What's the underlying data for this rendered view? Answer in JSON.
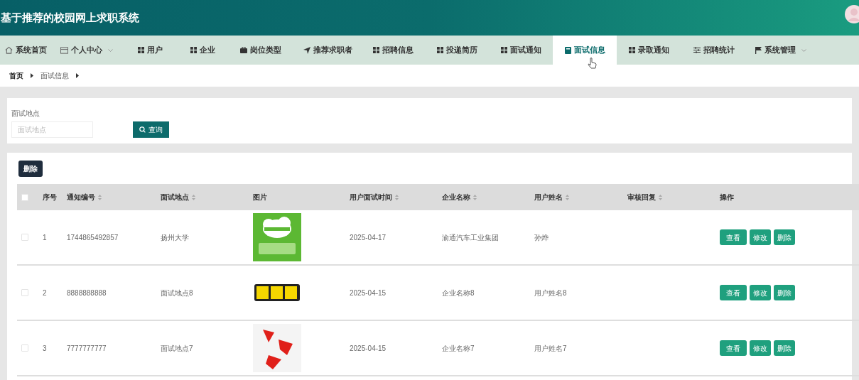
{
  "header": {
    "title": "基于推荐的校园网上求职系统"
  },
  "nav": [
    {
      "label": "系统首页",
      "selected": false,
      "dropdown": false
    },
    {
      "label": "个人中心",
      "selected": false,
      "dropdown": true
    },
    {
      "label": "用户",
      "selected": false,
      "dropdown": false
    },
    {
      "label": "企业",
      "selected": false,
      "dropdown": false
    },
    {
      "label": "岗位类型",
      "selected": false,
      "dropdown": false
    },
    {
      "label": "推荐求职者",
      "selected": false,
      "dropdown": false
    },
    {
      "label": "招聘信息",
      "selected": false,
      "dropdown": false
    },
    {
      "label": "投递简历",
      "selected": false,
      "dropdown": false
    },
    {
      "label": "面试通知",
      "selected": false,
      "dropdown": false
    },
    {
      "label": "面试信息",
      "selected": true,
      "dropdown": false
    },
    {
      "label": "录取通知",
      "selected": false,
      "dropdown": false
    },
    {
      "label": "招聘统计",
      "selected": false,
      "dropdown": false
    },
    {
      "label": "系统管理",
      "selected": false,
      "dropdown": true
    }
  ],
  "breadcrumb": [
    "首页",
    "面试信息"
  ],
  "search": {
    "label": "面试地点",
    "placeholder": "面试地点",
    "button": "查询"
  },
  "toolbar": {
    "delete_button": "删除"
  },
  "table": {
    "select_all_checked": false,
    "columns": [
      {
        "label": "序号",
        "sortable": false
      },
      {
        "label": "通知编号",
        "sortable": true
      },
      {
        "label": "面试地点",
        "sortable": true
      },
      {
        "label": "图片",
        "sortable": false
      },
      {
        "label": "用户面试时间",
        "sortable": true
      },
      {
        "label": "企业名称",
        "sortable": true
      },
      {
        "label": "用户姓名",
        "sortable": true
      },
      {
        "label": "审核回复",
        "sortable": true
      },
      {
        "label": "操作",
        "sortable": false
      }
    ],
    "rows": [
      {
        "checked": false,
        "index": "1",
        "notice_no": "1744865492857",
        "location": "扬州大学",
        "interview_time": "2025-04-17",
        "company": "渝通汽车工业集团",
        "user_name": "孙烨",
        "actions": [
          "查看",
          "修改",
          "删除"
        ]
      },
      {
        "checked": false,
        "index": "2",
        "notice_no": "8888888888",
        "location": "面试地点8",
        "interview_time": "2025-04-15",
        "company": "企业名称8",
        "user_name": "用户姓名8",
        "actions": [
          "查看",
          "修改",
          "删除"
        ]
      },
      {
        "checked": false,
        "index": "3",
        "notice_no": "7777777777",
        "location": "面试地点7",
        "interview_time": "2025-04-15",
        "company": "企业名称7",
        "user_name": "用户姓名7",
        "actions": [
          "查看",
          "修改",
          "删除"
        ]
      }
    ]
  }
}
